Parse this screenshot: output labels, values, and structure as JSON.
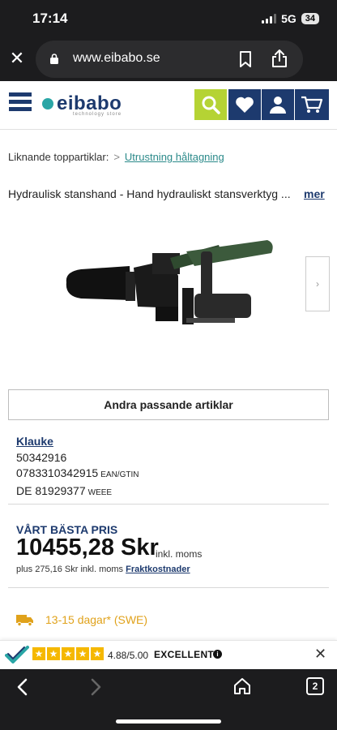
{
  "status": {
    "time": "17:14",
    "network": "5G",
    "battery": "34"
  },
  "browser": {
    "url": "www.eibabo.se",
    "tab_count": "2"
  },
  "site": {
    "logo_text": "eibabo",
    "logo_tagline": "technology store"
  },
  "breadcrumb": {
    "label": "Liknande toppartiklar:",
    "separator": ">",
    "link": "Utrustning håltagning"
  },
  "product": {
    "title": "Hydraulisk stanshand - Hand hydrauliskt stansverktyg ...",
    "more_label": "mer",
    "alt_button": "Andra passande artiklar",
    "brand": "Klauke",
    "article_number": "50342916",
    "ean": "0783310342915",
    "ean_label": "EAN/GTIN",
    "weee": "DE 81929377",
    "weee_label": "WEEE"
  },
  "price": {
    "label": "VÅRT BÄSTA PRIS",
    "value": "10455,28 Skr",
    "vat": "inkl. moms",
    "shipping_prefix": "plus 275,16 Skr inkl. moms",
    "shipping_link": "Fraktkostnader"
  },
  "delivery": {
    "text": "13-15 dagar* (SWE)",
    "color": "#e0a21b"
  },
  "trust": {
    "rating": "4.88/5.00",
    "label": "EXCELLENT",
    "stars": 5
  },
  "colors": {
    "brand_navy": "#1d3a6e",
    "accent_green": "#b5d334",
    "teal": "#2aa6a6"
  },
  "icons": [
    "close-icon",
    "lock-icon",
    "bookmark-icon",
    "share-icon",
    "menu-icon",
    "search-icon",
    "heart-icon",
    "user-icon",
    "cart-icon",
    "chevron-right-icon",
    "truck-icon",
    "star-icon",
    "info-icon",
    "back-icon",
    "forward-icon",
    "home-icon",
    "tabs-icon"
  ]
}
